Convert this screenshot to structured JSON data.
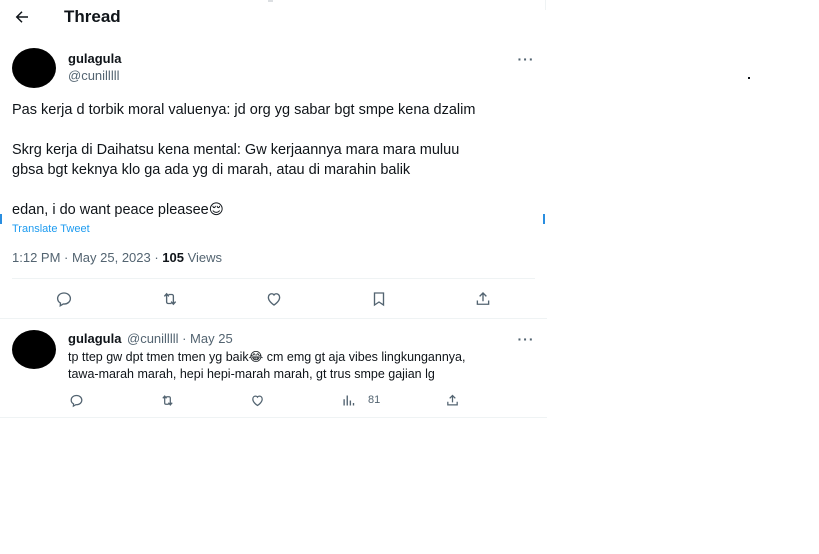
{
  "header": {
    "title": "Thread"
  },
  "tweet": {
    "name": "gulagula",
    "handle": "@cunilllll",
    "lines": [
      "Pas kerja d torbik moral valuenya: jd org yg sabar bgt smpe kena dzalim",
      "Skrg kerja di Daihatsu kena mental: Gw kerjaannya mara mara muluu",
      "gbsa bgt keknya klo ga ada yg di marah, atau di marahin balik",
      "edan, i do want peace pleasee"
    ],
    "emoji_last": "😌",
    "translate": "Translate Tweet",
    "time": "1:12 PM · May 25, 2023 · ",
    "views_count": "105",
    "views_label": " Views"
  },
  "reply": {
    "name": "gulagula",
    "handle_date": "@cunilllll · May 25",
    "line1": "tp ttep gw dpt tmen tmen yg baik",
    "emoji": "😂",
    "line1_rest": " cm emg gt aja vibes lingkungannya,",
    "line2": "tawa-marah marah, hepi hepi-marah marah, gt trus smpe gajian lg",
    "views": "81"
  },
  "icons": {
    "back": "arrow-left-icon",
    "more": "more-horizontal-icon",
    "reply": "comment-icon",
    "retweet": "retweet-icon",
    "like": "heart-icon",
    "bookmark": "bookmark-icon",
    "share": "share-icon",
    "views": "analytics-icon"
  },
  "colors": {
    "link": "#1d9bf0",
    "muted": "#536471",
    "text": "#0f1419"
  }
}
